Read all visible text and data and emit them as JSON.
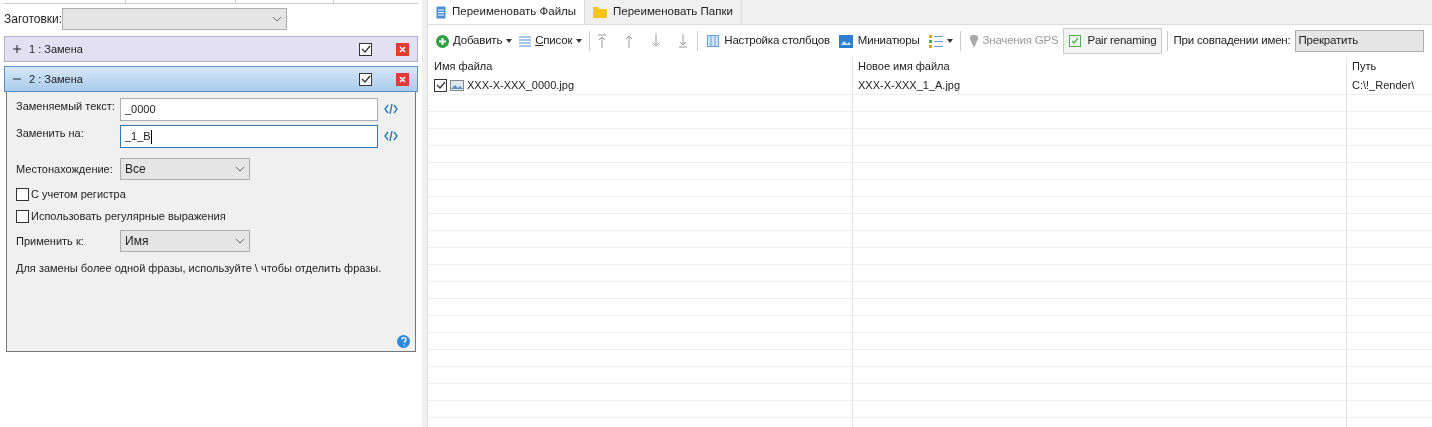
{
  "presets": {
    "label": "Заготовки:"
  },
  "rules": [
    {
      "title": "1 : Замена",
      "expanded": false,
      "checked": true
    },
    {
      "title": "2 : Замена",
      "expanded": true,
      "checked": true
    }
  ],
  "rule_form": {
    "fields": [
      {
        "label": "Заменяемый текст:",
        "value": "_0000",
        "focused": false
      },
      {
        "label": "Заменить на:",
        "value": "_1_B",
        "focused": true
      }
    ],
    "location": {
      "label": "Местонахождение:",
      "value": "Все"
    },
    "options": [
      {
        "label": "С учетом регистра",
        "checked": false
      },
      {
        "label": "Использовать регулярные выражения",
        "checked": false
      }
    ],
    "apply_to": {
      "label": "Применить к:",
      "value": "Имя"
    },
    "hint": "Для замены более одной фразы, используйте \\ чтобы отделить фразы."
  },
  "tabs": [
    {
      "label": "Переименовать Файлы",
      "selected": true,
      "kind": "file"
    },
    {
      "label": "Переименовать Папки",
      "selected": false,
      "kind": "folder"
    }
  ],
  "toolbar": {
    "add": "Добавить",
    "list": "Список",
    "columns": "Настройка столбцов",
    "thumbnails": "Миниатюры",
    "gps": "Значения GPS",
    "pair": {
      "label": "Pair renaming",
      "checked": true
    },
    "conflict_label": "При совпадении имен:",
    "conflict_value": "Прекратить"
  },
  "table": {
    "columns": [
      "Имя файла",
      "Новое имя файла",
      "Путь"
    ],
    "rows": [
      {
        "checked": true,
        "cells": [
          "XXX-X-XXX_0000.jpg",
          "XXX-X-XXX_1_A.jpg",
          "C:\\!_Render\\"
        ]
      }
    ]
  }
}
